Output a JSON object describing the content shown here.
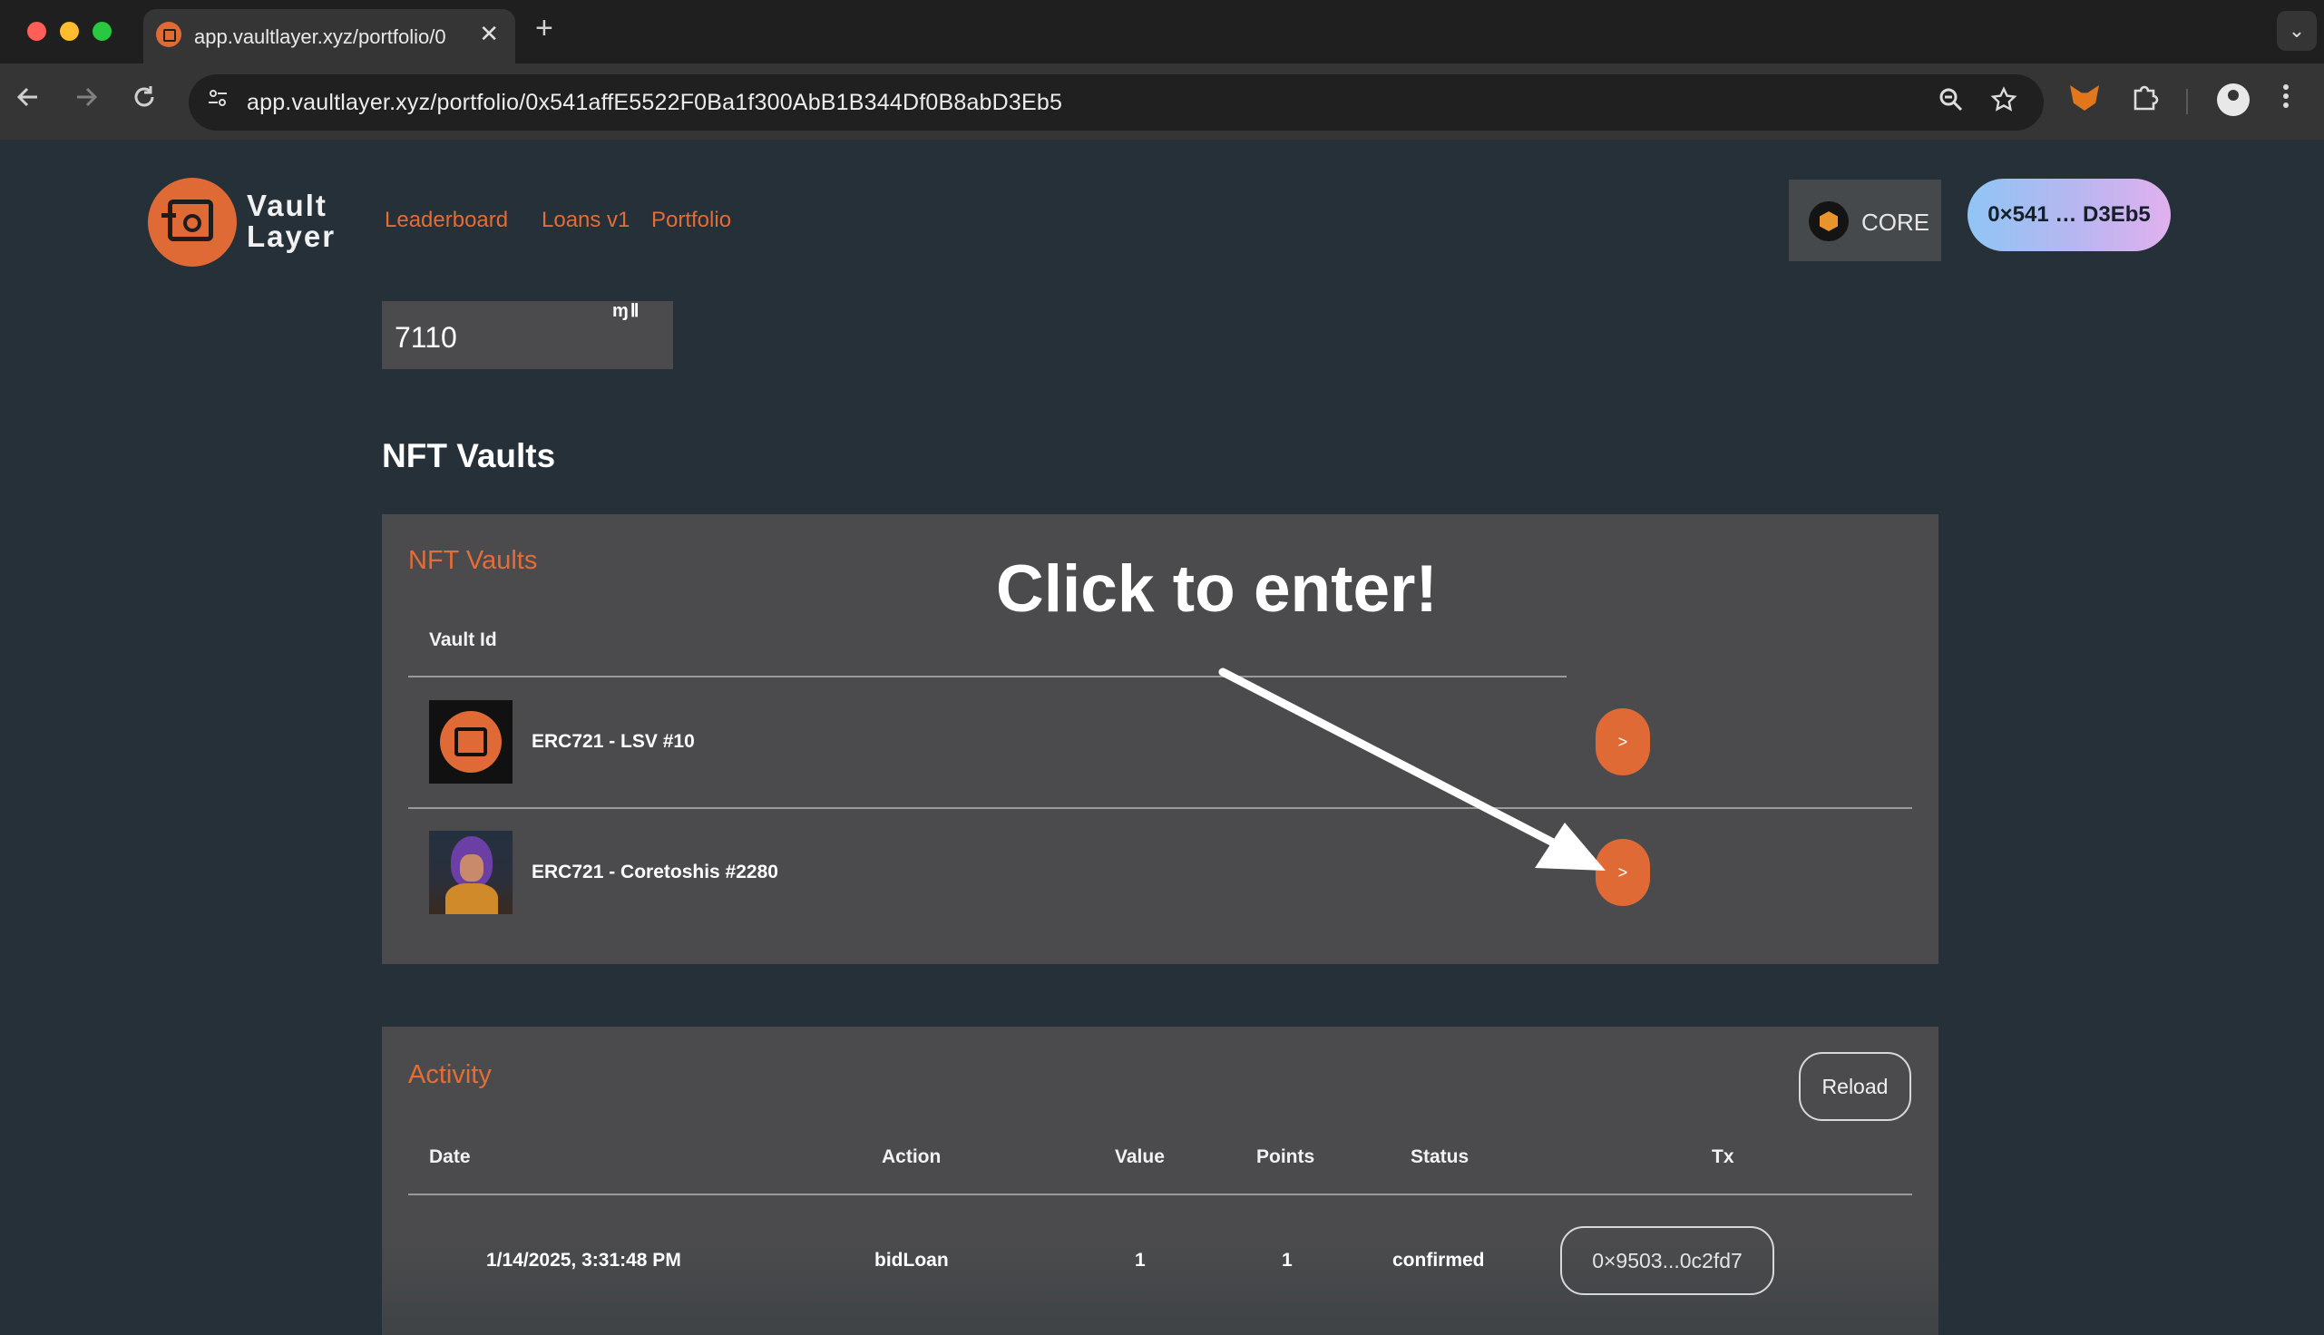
{
  "browser": {
    "tab_title": "app.vaultlayer.xyz/portfolio/0",
    "tab_close": "✕",
    "new_tab": "+",
    "tab_menu": "⌄",
    "url": "app.vaultlayer.xyz/portfolio/0x541affE5522F0Ba1f300AbB1B344Df0B8abD3Eb5",
    "icons": [
      "back-icon",
      "forward-icon",
      "reload-icon",
      "site-settings-icon",
      "zoom-icon",
      "bookmark-star-icon",
      "metamask-icon",
      "extensions-icon",
      "profile-icon",
      "menu-icon"
    ]
  },
  "header": {
    "logo_line1": "Vault",
    "logo_line2": "Layer",
    "nav": [
      "Leaderboard",
      "Loans v1",
      "Portfolio"
    ],
    "network_label": "CORE",
    "wallet_label": "0×541 … D3Eb5"
  },
  "stats": {
    "card_fragment": "ɱⅡ",
    "value": "7110"
  },
  "nft_section": {
    "heading": "NFT Vaults",
    "panel_title": "NFT Vaults",
    "column_header": "Vault Id",
    "vaults": [
      {
        "name": "ERC721 - LSV #10",
        "button": ">"
      },
      {
        "name": "ERC721 - Coretoshis #2280",
        "button": ">"
      }
    ]
  },
  "annotation": {
    "text": "Click to enter!"
  },
  "activity": {
    "title": "Activity",
    "reload_label": "Reload",
    "columns": [
      "Date",
      "Action",
      "Value",
      "Points",
      "Status",
      "Tx"
    ],
    "rows": [
      {
        "date": "1/14/2025, 3:31:48 PM",
        "action": "bidLoan",
        "value": "1",
        "points": "1",
        "status": "confirmed",
        "tx": "0×9503...0c2fd7"
      }
    ]
  },
  "colors": {
    "accent": "#e06a35",
    "page_bg": "#253038",
    "panel_bg": "#4b4b4d"
  }
}
